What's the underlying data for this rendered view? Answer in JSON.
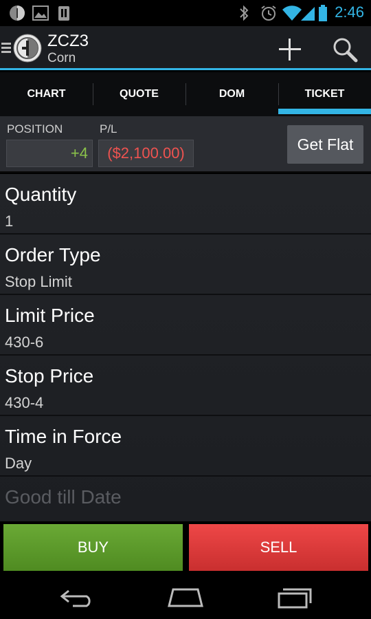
{
  "status_bar": {
    "time": "2:46",
    "icons": [
      "app-icon",
      "image-icon",
      "clipboard-icon",
      "bluetooth-icon",
      "alarm-icon",
      "wifi-icon",
      "signal-icon",
      "battery-icon"
    ]
  },
  "action_bar": {
    "title": "ZCZ3",
    "subtitle": "Corn",
    "add_icon": "plus-icon",
    "search_icon": "search-icon"
  },
  "tabs": [
    {
      "label": "CHART"
    },
    {
      "label": "QUOTE"
    },
    {
      "label": "DOM"
    },
    {
      "label": "TICKET",
      "selected": true
    }
  ],
  "position": {
    "position_label": "POSITION",
    "position_value": "+4",
    "pl_label": "P/L",
    "pl_value": "($2,100.00)",
    "get_flat_label": "Get Flat"
  },
  "form": {
    "quantity": {
      "label": "Quantity",
      "value": "1"
    },
    "order_type": {
      "label": "Order Type",
      "value": "Stop Limit"
    },
    "limit_price": {
      "label": "Limit Price",
      "value": "430-6"
    },
    "stop_price": {
      "label": "Stop Price",
      "value": "430-4"
    },
    "time_in_force": {
      "label": "Time in Force",
      "value": "Day"
    },
    "good_till_date": {
      "label": "Good till Date"
    }
  },
  "actions": {
    "buy_label": "BUY",
    "sell_label": "SELL"
  },
  "colors": {
    "accent": "#33b5e5",
    "positive": "#8bc34a",
    "negative": "#ef5350",
    "buy": "#5a9a2a",
    "sell": "#dd3b3b"
  },
  "nav_bar": {
    "icons": [
      "back-icon",
      "home-icon",
      "recent-apps-icon"
    ]
  }
}
